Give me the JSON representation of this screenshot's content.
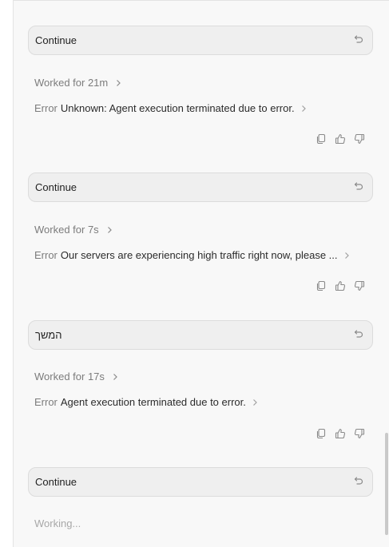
{
  "colors": {
    "panel_bg": "#f8f8f8",
    "bubble_bg": "#efefef",
    "muted_text": "#7c7c7c",
    "icon": "#8a8a8a"
  },
  "turns": [
    {
      "user_message": "Continue",
      "worked_for": "Worked for 21m",
      "error_label": "Error",
      "error_message": "Unknown: Agent execution terminated due to error.",
      "actions": [
        "copy-icon",
        "thumbs-up-icon",
        "thumbs-down-icon"
      ]
    },
    {
      "user_message": "Continue",
      "worked_for": "Worked for 7s",
      "error_label": "Error",
      "error_message": "Our servers are experiencing high traffic right now, please ...",
      "actions": [
        "copy-icon",
        "thumbs-up-icon",
        "thumbs-down-icon"
      ]
    },
    {
      "user_message": "המשך",
      "worked_for": "Worked for 17s",
      "error_label": "Error",
      "error_message": "Agent execution terminated due to error.",
      "actions": [
        "copy-icon",
        "thumbs-up-icon",
        "thumbs-down-icon"
      ]
    }
  ],
  "last_message": "Continue",
  "status": "Working..."
}
